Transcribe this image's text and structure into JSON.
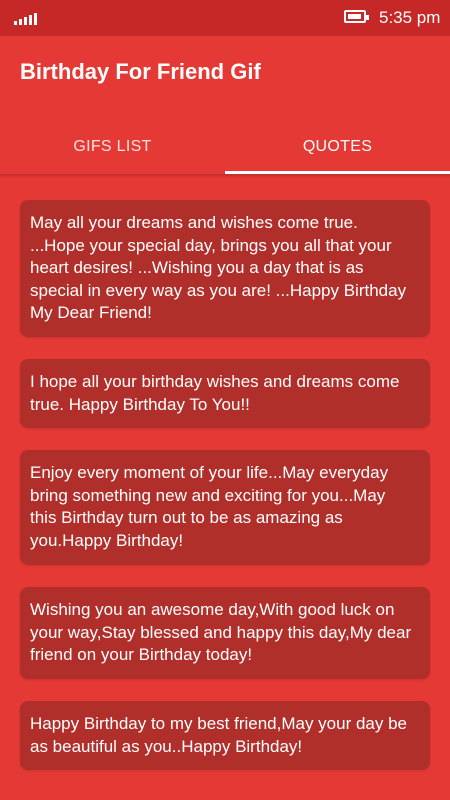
{
  "status_bar": {
    "time": "5:35 pm",
    "signal_icon": "signal-icon",
    "battery_icon": "battery-icon"
  },
  "app_bar": {
    "title": "Birthday For Friend Gif"
  },
  "tabs": [
    {
      "label": "GIFS LIST",
      "active": false
    },
    {
      "label": "QUOTES",
      "active": true
    }
  ],
  "quotes": [
    {
      "text": "May all your dreams and wishes come true. ...Hope your special day, brings you all that your heart desires! ...Wishing you a day that is as special in every way as you are! ...Happy Birthday My Dear Friend!"
    },
    {
      "text": "I hope all your birthday wishes and dreams come true. Happy Birthday To You!!"
    },
    {
      "text": "Enjoy every moment of your life...May everyday bring something new and exciting for you...May this Birthday turn out to be as amazing as you.Happy Birthday!"
    },
    {
      "text": "Wishing you an awesome day,With good luck on your way,Stay blessed and happy this day,My dear friend on your Birthday today!"
    },
    {
      "text": "Happy Birthday to my best friend,May your day be as beautiful as you..Happy Birthday!"
    }
  ],
  "colors": {
    "primary": "#e53935",
    "status_bar": "#c62828",
    "card": "#b12f2b",
    "text": "#ffffff"
  }
}
